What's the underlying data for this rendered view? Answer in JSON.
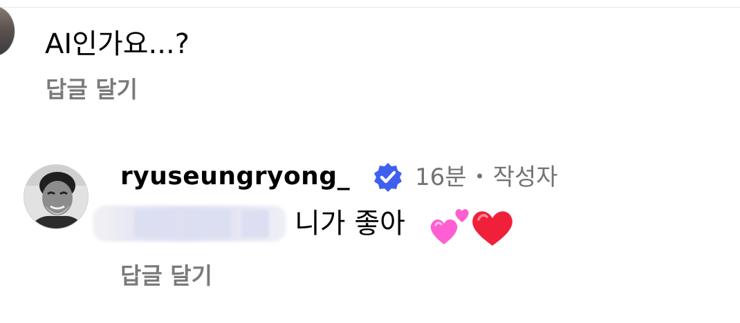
{
  "comments": [
    {
      "text": "AI인가요...?",
      "reply_label": "답글 달기"
    },
    {
      "username": "ryuseungryong_",
      "verified": true,
      "time": "16분",
      "separator": "•",
      "role_badge": "작성자",
      "text": "니가 좋아",
      "emojis": [
        "two-hearts",
        "red-heart"
      ],
      "reply_label": "답글 달기"
    }
  ],
  "colors": {
    "verified_badge": "#3f5ff0",
    "secondary_text": "#737373",
    "pink_heart": "#ff5fd2",
    "red_heart": "#f0203a"
  }
}
